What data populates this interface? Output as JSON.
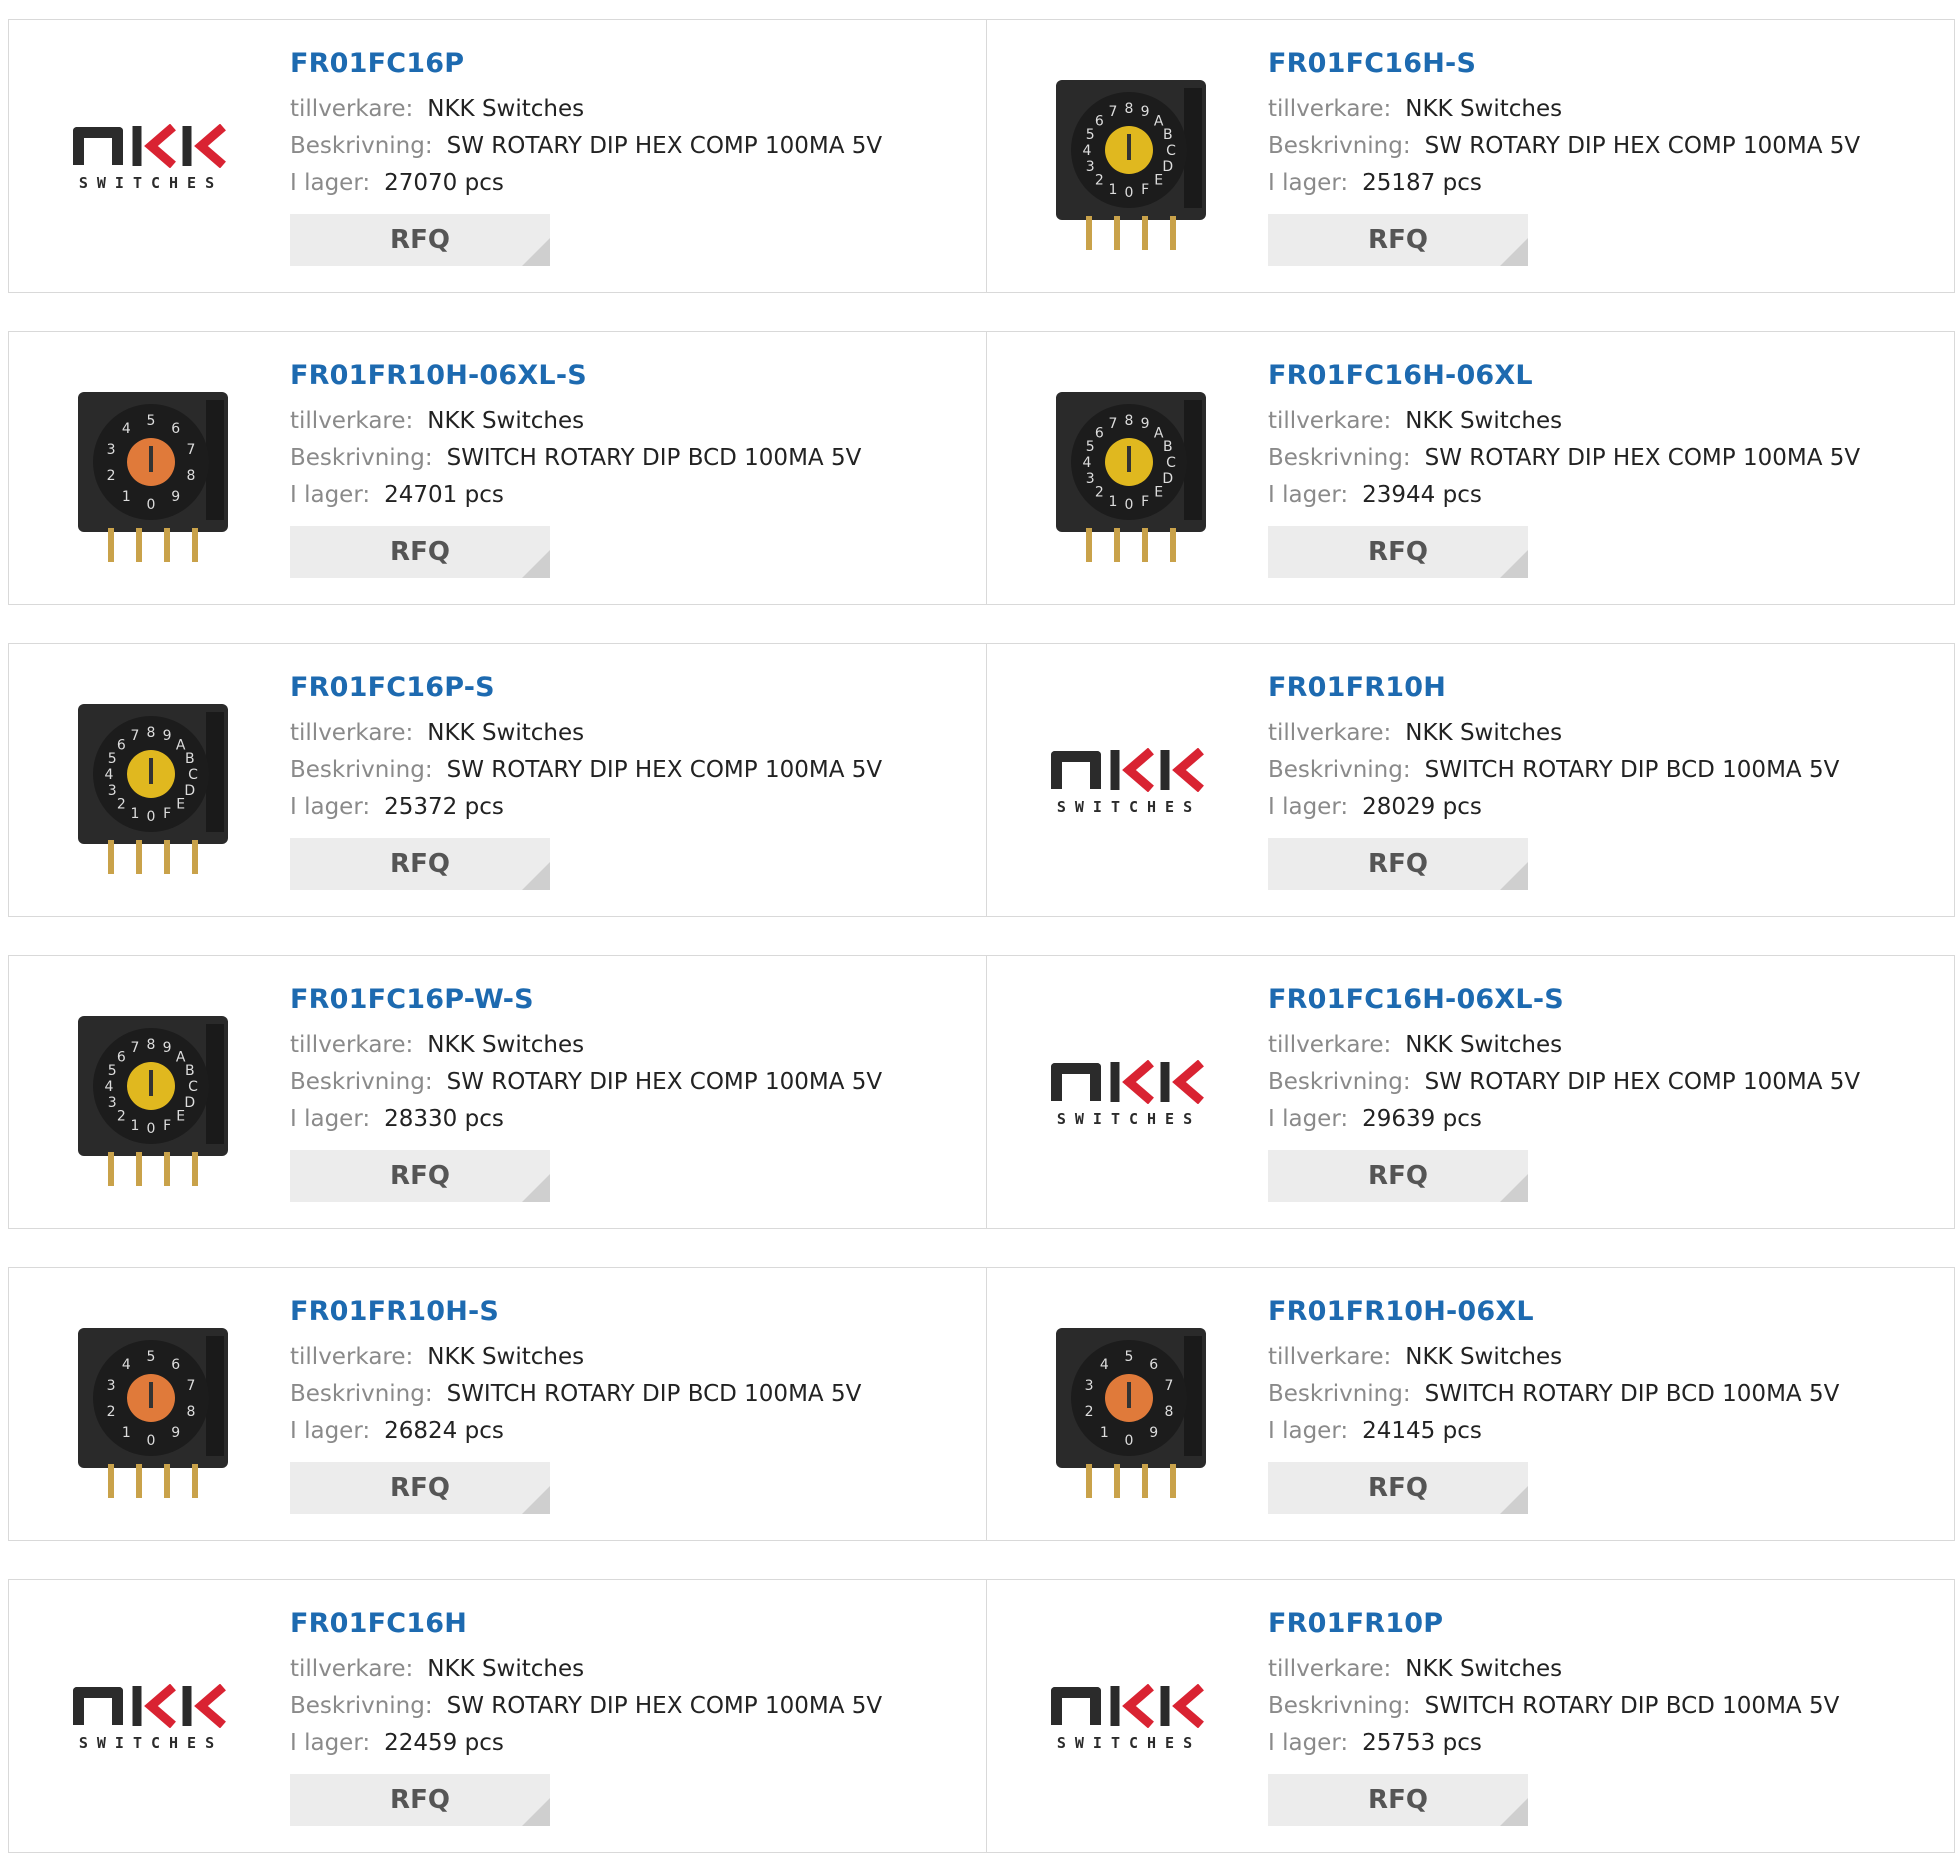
{
  "labels": {
    "manufacturer": "tillverkare:",
    "description": "Beskrivning:",
    "stock": "I lager:",
    "rfq": "RFQ"
  },
  "logo": {
    "mark": "nKK",
    "text": "SWITCHES"
  },
  "products": [
    {
      "part": "FR01FC16P",
      "manufacturer": "NKK Switches",
      "description": "SW ROTARY DIP HEX COMP 100MA 5V",
      "stock": "27070 pcs",
      "image": "nkk-logo"
    },
    {
      "part": "FR01FC16H-S",
      "manufacturer": "NKK Switches",
      "description": "SW ROTARY DIP HEX COMP 100MA 5V",
      "stock": "25187 pcs",
      "image": "switch-side-yellow"
    },
    {
      "part": "FR01FR10H-06XL-S",
      "manufacturer": "NKK Switches",
      "description": "SWITCH ROTARY DIP BCD 100MA 5V",
      "stock": "24701 pcs",
      "image": "switch-angled-orange"
    },
    {
      "part": "FR01FC16H-06XL",
      "manufacturer": "NKK Switches",
      "description": "SW ROTARY DIP HEX COMP 100MA 5V",
      "stock": "23944 pcs",
      "image": "switch-angled-yellow"
    },
    {
      "part": "FR01FC16P-S",
      "manufacturer": "NKK Switches",
      "description": "SW ROTARY DIP HEX COMP 100MA 5V",
      "stock": "25372 pcs",
      "image": "switch-top-yellow"
    },
    {
      "part": "FR01FR10H",
      "manufacturer": "NKK Switches",
      "description": "SWITCH ROTARY DIP BCD 100MA 5V",
      "stock": "28029 pcs",
      "image": "nkk-logo"
    },
    {
      "part": "FR01FC16P-W-S",
      "manufacturer": "NKK Switches",
      "description": "SW ROTARY DIP HEX COMP 100MA 5V",
      "stock": "28330 pcs",
      "image": "switch-top-yellow"
    },
    {
      "part": "FR01FC16H-06XL-S",
      "manufacturer": "NKK Switches",
      "description": "SW ROTARY DIP HEX COMP 100MA 5V",
      "stock": "29639 pcs",
      "image": "nkk-logo"
    },
    {
      "part": "FR01FR10H-S",
      "manufacturer": "NKK Switches",
      "description": "SWITCH ROTARY DIP BCD 100MA 5V",
      "stock": "26824 pcs",
      "image": "switch-side-orange"
    },
    {
      "part": "FR01FR10H-06XL",
      "manufacturer": "NKK Switches",
      "description": "SWITCH ROTARY DIP BCD 100MA 5V",
      "stock": "24145 pcs",
      "image": "switch-angled-orange"
    },
    {
      "part": "FR01FC16H",
      "manufacturer": "NKK Switches",
      "description": "SW ROTARY DIP HEX COMP 100MA 5V",
      "stock": "22459 pcs",
      "image": "nkk-logo"
    },
    {
      "part": "FR01FR10P",
      "manufacturer": "NKK Switches",
      "description": "SWITCH ROTARY DIP BCD 100MA 5V",
      "stock": "25753 pcs",
      "image": "nkk-logo"
    }
  ],
  "colors": {
    "link": "#1d6ab0",
    "label": "#8a8a8a",
    "button_bg": "#ececec",
    "border": "#d9d9d9",
    "logo_red": "#d92332",
    "dial_yellow": "#e0b81f",
    "dial_orange": "#e07a3a"
  }
}
